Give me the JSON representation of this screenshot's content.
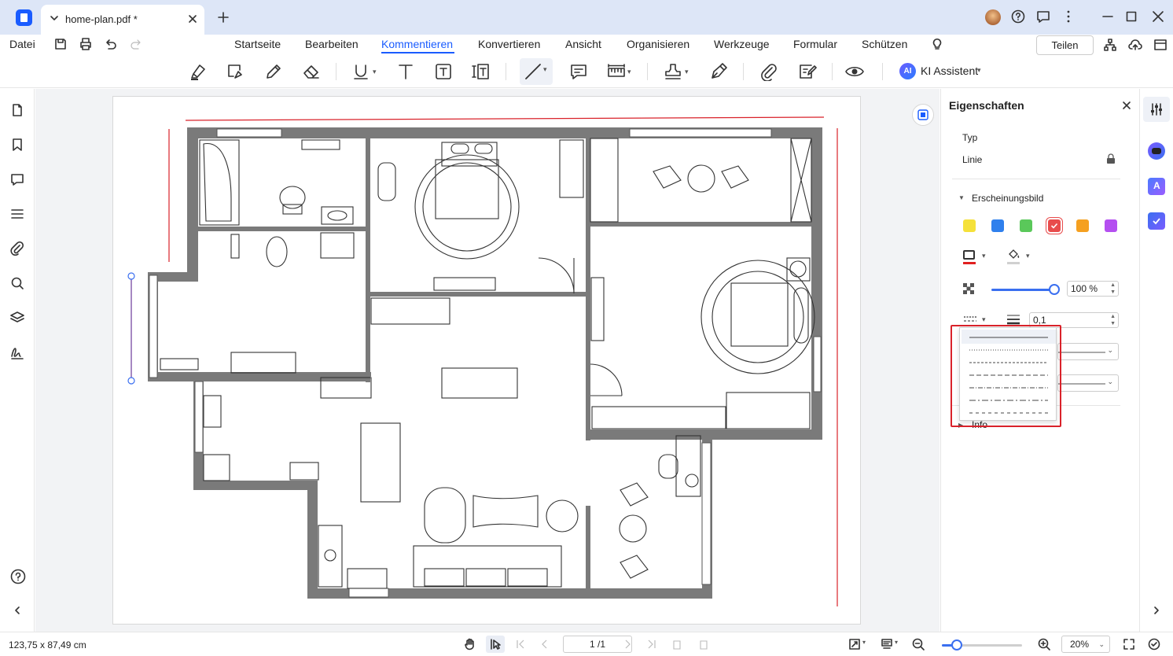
{
  "titlebar": {
    "tab_title": "home-plan.pdf *"
  },
  "menu": {
    "file": "Datei",
    "items": [
      "Startseite",
      "Bearbeiten",
      "Kommentieren",
      "Konvertieren",
      "Ansicht",
      "Organisieren",
      "Werkzeuge",
      "Formular",
      "Schützen"
    ],
    "active": "Kommentieren",
    "share": "Teilen"
  },
  "toolbar": {
    "ai_badge": "AI",
    "ai_label": "KI Assistent"
  },
  "properties": {
    "title": "Eigenschaften",
    "type_label": "Typ",
    "type_value": "Linie",
    "appearance_label": "Erscheinungsbild",
    "colors": [
      "#f5e13a",
      "#2f80ed",
      "#5ac85a",
      "#e84c4c",
      "#f5a020",
      "#b44ff0"
    ],
    "selected_color": "#e84c4c",
    "opacity": "100 %",
    "opacity_value": 1.0,
    "line_width": "0,1",
    "dash_styles": [
      "solid",
      "dotted",
      "dashed-short",
      "dashed",
      "dash-dot",
      "dash-dot-long",
      "dashed-long"
    ],
    "info_label": "Info"
  },
  "statusbar": {
    "dimensions": "123,75 x 87,49 cm",
    "page": "1 /1",
    "zoom": "20%",
    "zoom_level": 0.2
  }
}
